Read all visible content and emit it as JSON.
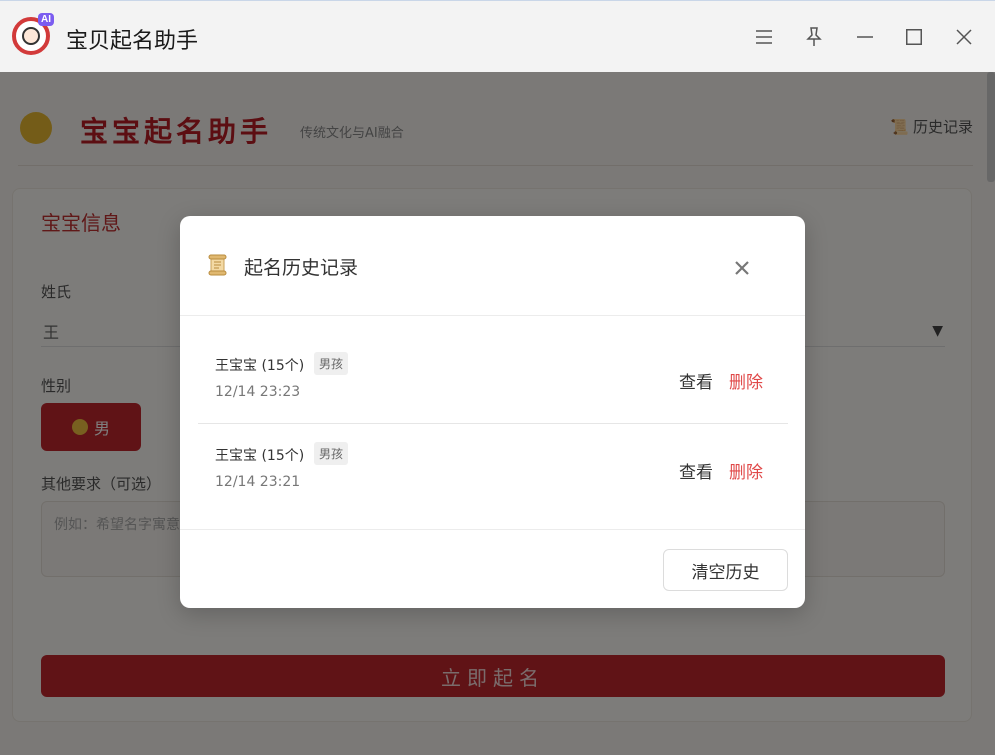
{
  "window": {
    "title": "宝贝起名助手",
    "logo_badge": "AI"
  },
  "app": {
    "header_title": "宝宝起名助手",
    "header_subtitle": "传统文化与AI融合",
    "history_link": "历史记录",
    "section_title": "宝宝信息",
    "surname_label": "姓氏",
    "surname_value": "王",
    "gender_label": "性别",
    "gender_selected": "男",
    "requirements_label": "其他要求（可选）",
    "requirements_placeholder": "例如：希望名字寓意...",
    "submit_label": "立即起名"
  },
  "dialog": {
    "icon": "scroll-icon",
    "title": "起名历史记录",
    "items": [
      {
        "name": "王宝宝 (15个)",
        "tag": "男孩",
        "time": "12/14 23:23",
        "view": "查看",
        "delete": "删除"
      },
      {
        "name": "王宝宝 (15个)",
        "tag": "男孩",
        "time": "12/14 23:21",
        "view": "查看",
        "delete": "删除"
      }
    ],
    "clear_label": "清空历史"
  },
  "colors": {
    "accent_red": "#c0262c",
    "delete_red": "#e04848",
    "overlay": "rgba(0,0,0,0.5)"
  }
}
